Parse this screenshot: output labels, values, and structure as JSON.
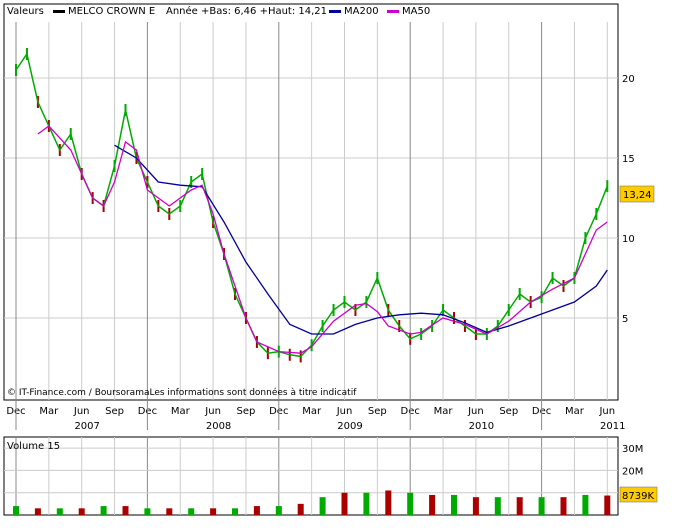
{
  "header": {
    "label": "Valeurs",
    "series_name": "MELCO CROWN E",
    "stats": "Année +Bas: 6,46 +Haut: 14,21",
    "ma200_label": "MA200",
    "ma50_label": "MA50"
  },
  "credit": "© IT-Finance.com / BoursoramaLes informations sont données à titre indicatif",
  "last_price_badge": "13,24",
  "volume_title": "Volume 15",
  "volume_badge": "8739K",
  "colors": {
    "price_up": "#00aa00",
    "price_down": "#aa0000",
    "ma200": "#000099",
    "ma50": "#cc00cc",
    "badge_bg": "#ffcc00",
    "grid": "#cccccc"
  },
  "chart_data": [
    {
      "type": "line",
      "title": "MELCO CROWN E",
      "ylim": [
        1.5,
        23.5
      ],
      "y_ticks": [
        5,
        10,
        15,
        20
      ],
      "y_tick_labels": [
        "5",
        "10",
        "15",
        "20"
      ],
      "x_tick_labels": [
        "Dec",
        "Mar",
        "Jun",
        "Sep",
        "Dec",
        "Mar",
        "Jun",
        "Sep",
        "Dec",
        "Mar",
        "Jun",
        "Sep",
        "Dec",
        "Mar",
        "Jun",
        "Sep",
        "Dec",
        "Mar",
        "Jun"
      ],
      "year_labels": [
        "2007",
        "2008",
        "2009",
        "2010",
        "2011"
      ],
      "grid": true,
      "legend": "top",
      "series": [
        {
          "name": "MELCO CROWN E",
          "x": [
            "2006-12",
            "2007-01",
            "2007-02",
            "2007-03",
            "2007-04",
            "2007-05",
            "2007-06",
            "2007-07",
            "2007-08",
            "2007-09",
            "2007-10",
            "2007-11",
            "2007-12",
            "2008-01",
            "2008-02",
            "2008-03",
            "2008-04",
            "2008-05",
            "2008-06",
            "2008-07",
            "2008-08",
            "2008-09",
            "2008-10",
            "2008-11",
            "2008-12",
            "2009-01",
            "2009-02",
            "2009-03",
            "2009-04",
            "2009-05",
            "2009-06",
            "2009-07",
            "2009-08",
            "2009-09",
            "2009-10",
            "2009-11",
            "2009-12",
            "2010-01",
            "2010-02",
            "2010-03",
            "2010-04",
            "2010-05",
            "2010-06",
            "2010-07",
            "2010-08",
            "2010-09",
            "2010-10",
            "2010-11",
            "2010-12",
            "2011-01",
            "2011-02",
            "2011-03",
            "2011-04",
            "2011-05",
            "2011-06"
          ],
          "values": [
            20.5,
            21.5,
            18.5,
            17.0,
            15.5,
            16.5,
            14.0,
            12.5,
            12.0,
            14.5,
            18.0,
            15.0,
            13.5,
            12.0,
            11.5,
            12.0,
            13.5,
            14.0,
            11.0,
            9.0,
            6.5,
            5.0,
            3.5,
            2.8,
            2.9,
            2.7,
            2.6,
            3.3,
            4.5,
            5.5,
            6.0,
            5.5,
            6.0,
            7.5,
            5.5,
            4.5,
            3.7,
            4.0,
            4.5,
            5.5,
            5.0,
            4.5,
            4.0,
            4.0,
            4.5,
            5.5,
            6.5,
            6.0,
            6.3,
            7.5,
            7.0,
            7.5,
            10.0,
            11.5,
            13.24
          ]
        },
        {
          "name": "MA200",
          "x": [
            "2007-09",
            "2007-11",
            "2008-01",
            "2008-03",
            "2008-05",
            "2008-07",
            "2008-09",
            "2008-11",
            "2009-01",
            "2009-03",
            "2009-05",
            "2009-07",
            "2009-09",
            "2009-11",
            "2010-01",
            "2010-03",
            "2010-05",
            "2010-07",
            "2010-09",
            "2010-11",
            "2011-01",
            "2011-03",
            "2011-05",
            "2011-06"
          ],
          "values": [
            15.8,
            15.0,
            13.5,
            13.3,
            13.2,
            11.0,
            8.5,
            6.5,
            4.6,
            4.0,
            4.0,
            4.6,
            5.0,
            5.2,
            5.3,
            5.2,
            4.7,
            4.1,
            4.5,
            5.0,
            5.5,
            6.0,
            7.0,
            8.0
          ]
        },
        {
          "name": "MA50",
          "x": [
            "2007-02",
            "2007-03",
            "2007-05",
            "2007-07",
            "2007-08",
            "2007-09",
            "2007-10",
            "2007-11",
            "2007-12",
            "2008-02",
            "2008-04",
            "2008-05",
            "2008-06",
            "2008-07",
            "2008-08",
            "2008-09",
            "2008-10",
            "2008-12",
            "2009-02",
            "2009-03",
            "2009-05",
            "2009-07",
            "2009-08",
            "2009-09",
            "2009-10",
            "2009-12",
            "2010-01",
            "2010-03",
            "2010-05",
            "2010-07",
            "2010-09",
            "2010-11",
            "2011-01",
            "2011-03",
            "2011-05",
            "2011-06"
          ],
          "values": [
            16.5,
            17.0,
            15.5,
            12.5,
            12.0,
            13.5,
            16.0,
            15.5,
            13.0,
            12.0,
            13.0,
            13.3,
            11.5,
            9.0,
            7.0,
            5.0,
            3.5,
            2.9,
            2.8,
            3.2,
            4.8,
            5.8,
            5.9,
            5.4,
            4.5,
            4.0,
            4.1,
            5.0,
            4.6,
            4.0,
            4.8,
            6.0,
            6.8,
            7.5,
            10.5,
            11.0
          ]
        }
      ]
    },
    {
      "type": "bar",
      "title": "Volume 15",
      "ylim": [
        0,
        35
      ],
      "y_ticks": [
        10,
        20,
        30
      ],
      "y_tick_labels": [
        "10M",
        "20M",
        "30M"
      ],
      "x": [
        "2006-12",
        "2007-02",
        "2007-04",
        "2007-06",
        "2007-08",
        "2007-10",
        "2007-12",
        "2008-02",
        "2008-04",
        "2008-06",
        "2008-08",
        "2008-10",
        "2008-12",
        "2009-02",
        "2009-04",
        "2009-06",
        "2009-08",
        "2009-10",
        "2009-12",
        "2010-02",
        "2010-04",
        "2010-06",
        "2010-08",
        "2010-10",
        "2010-12",
        "2011-02",
        "2011-04",
        "2011-06"
      ],
      "values": [
        4,
        3,
        3,
        3,
        4,
        4,
        3,
        3,
        3,
        3,
        3,
        4,
        4,
        5,
        8,
        10,
        10,
        11,
        10,
        9,
        9,
        8,
        8,
        8,
        8,
        8,
        9,
        8.739
      ],
      "last_value_label": "8739K"
    }
  ]
}
